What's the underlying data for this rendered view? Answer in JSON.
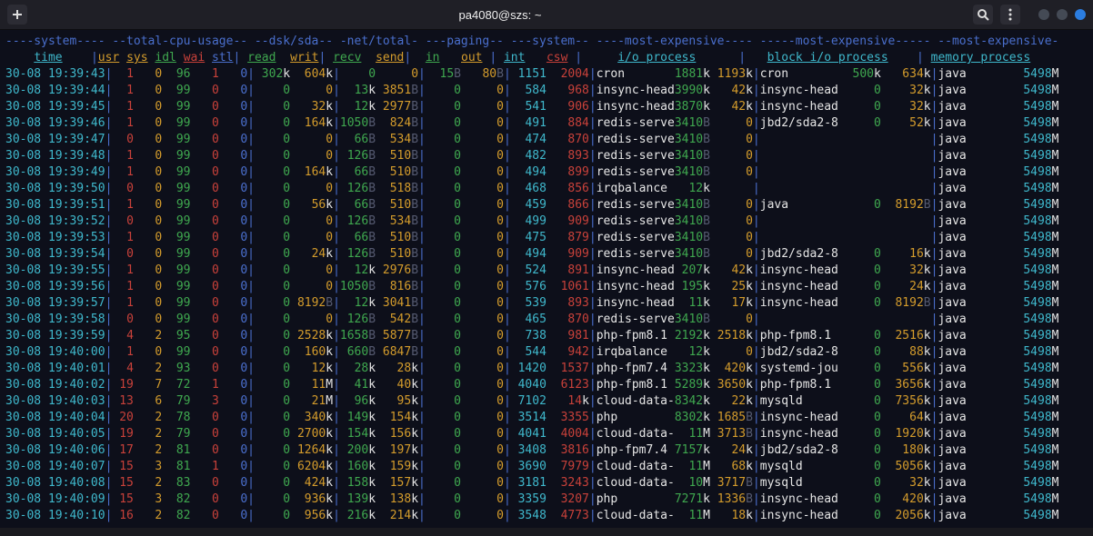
{
  "window": {
    "title": "pa4080@szs: ~"
  },
  "header": {
    "groups": "----system---- --total-cpu-usage-- --dsk/sda-- -net/total- ---paging-- ---system-- ----most-expensive---- -----most-expensive----- --most-expensive-",
    "sub": "    time    |usr sys idl wai stl| read  writ| recv  send|  in   out | int   csw |     i/o process      |   block i/o process    | memory process "
  },
  "rows": [
    {
      "time": "30-08 19:39:43",
      "usr": "1",
      "sys": "0",
      "idl": "96",
      "wai": "1",
      "stl": "0",
      "read": "302k",
      "writ": "604k",
      "recv": "0",
      "send": "0",
      "pin": "15B",
      "pout": "80B",
      "int": "1151",
      "csw": "2004",
      "io": {
        "name": "cron",
        "a": "1881k",
        "b": "1193k"
      },
      "blk": {
        "name": "cron",
        "a": "500k",
        "b": "634k"
      },
      "mem": {
        "name": "java",
        "v": "5498M"
      }
    },
    {
      "time": "30-08 19:39:44",
      "usr": "1",
      "sys": "0",
      "idl": "99",
      "wai": "0",
      "stl": "0",
      "read": "0",
      "writ": "0",
      "recv": "13k",
      "send": "3851B",
      "pin": "0",
      "pout": "0",
      "int": "584",
      "csw": "968",
      "io": {
        "name": "insync-head",
        "a": "3990k",
        "b": "42k"
      },
      "blk": {
        "name": "insync-head",
        "a": "0",
        "b": "32k"
      },
      "mem": {
        "name": "java",
        "v": "5498M"
      }
    },
    {
      "time": "30-08 19:39:45",
      "usr": "1",
      "sys": "0",
      "idl": "99",
      "wai": "0",
      "stl": "0",
      "read": "0",
      "writ": "32k",
      "recv": "12k",
      "send": "2977B",
      "pin": "0",
      "pout": "0",
      "int": "541",
      "csw": "906",
      "io": {
        "name": "insync-head",
        "a": "3870k",
        "b": "42k"
      },
      "blk": {
        "name": "insync-head",
        "a": "0",
        "b": "32k"
      },
      "mem": {
        "name": "java",
        "v": "5498M"
      }
    },
    {
      "time": "30-08 19:39:46",
      "usr": "1",
      "sys": "0",
      "idl": "99",
      "wai": "0",
      "stl": "0",
      "read": "0",
      "writ": "164k",
      "recv": "1050B",
      "send": "824B",
      "pin": "0",
      "pout": "0",
      "int": "491",
      "csw": "884",
      "io": {
        "name": "redis-serve",
        "a": "3410B",
        "b": "0"
      },
      "blk": {
        "name": "jbd2/sda2-8",
        "a": "0",
        "b": "52k"
      },
      "mem": {
        "name": "java",
        "v": "5498M"
      }
    },
    {
      "time": "30-08 19:39:47",
      "usr": "0",
      "sys": "0",
      "idl": "99",
      "wai": "0",
      "stl": "0",
      "read": "0",
      "writ": "0",
      "recv": "66B",
      "send": "534B",
      "pin": "0",
      "pout": "0",
      "int": "474",
      "csw": "870",
      "io": {
        "name": "redis-serve",
        "a": "3410B",
        "b": "0"
      },
      "blk": {
        "name": "",
        "a": "",
        "b": ""
      },
      "mem": {
        "name": "java",
        "v": "5498M"
      }
    },
    {
      "time": "30-08 19:39:48",
      "usr": "1",
      "sys": "0",
      "idl": "99",
      "wai": "0",
      "stl": "0",
      "read": "0",
      "writ": "0",
      "recv": "126B",
      "send": "510B",
      "pin": "0",
      "pout": "0",
      "int": "482",
      "csw": "893",
      "io": {
        "name": "redis-serve",
        "a": "3410B",
        "b": "0"
      },
      "blk": {
        "name": "",
        "a": "",
        "b": ""
      },
      "mem": {
        "name": "java",
        "v": "5498M"
      }
    },
    {
      "time": "30-08 19:39:49",
      "usr": "1",
      "sys": "0",
      "idl": "99",
      "wai": "0",
      "stl": "0",
      "read": "0",
      "writ": "164k",
      "recv": "66B",
      "send": "510B",
      "pin": "0",
      "pout": "0",
      "int": "494",
      "csw": "899",
      "io": {
        "name": "redis-serve",
        "a": "3410B",
        "b": "0"
      },
      "blk": {
        "name": "",
        "a": "",
        "b": ""
      },
      "mem": {
        "name": "java",
        "v": "5498M"
      }
    },
    {
      "time": "30-08 19:39:50",
      "usr": "0",
      "sys": "0",
      "idl": "99",
      "wai": "0",
      "stl": "0",
      "read": "0",
      "writ": "0",
      "recv": "126B",
      "send": "518B",
      "pin": "0",
      "pout": "0",
      "int": "468",
      "csw": "856",
      "io": {
        "name": "irqbalance",
        "a": "12k",
        "b": ""
      },
      "blk": {
        "name": "",
        "a": "",
        "b": ""
      },
      "mem": {
        "name": "java",
        "v": "5498M"
      }
    },
    {
      "time": "30-08 19:39:51",
      "usr": "1",
      "sys": "0",
      "idl": "99",
      "wai": "0",
      "stl": "0",
      "read": "0",
      "writ": "56k",
      "recv": "66B",
      "send": "510B",
      "pin": "0",
      "pout": "0",
      "int": "459",
      "csw": "866",
      "io": {
        "name": "redis-serve",
        "a": "3410B",
        "b": "0"
      },
      "blk": {
        "name": "java",
        "a": "0",
        "b": "8192B"
      },
      "mem": {
        "name": "java",
        "v": "5498M"
      }
    },
    {
      "time": "30-08 19:39:52",
      "usr": "0",
      "sys": "0",
      "idl": "99",
      "wai": "0",
      "stl": "0",
      "read": "0",
      "writ": "0",
      "recv": "126B",
      "send": "534B",
      "pin": "0",
      "pout": "0",
      "int": "499",
      "csw": "909",
      "io": {
        "name": "redis-serve",
        "a": "3410B",
        "b": "0"
      },
      "blk": {
        "name": "",
        "a": "",
        "b": ""
      },
      "mem": {
        "name": "java",
        "v": "5498M"
      }
    },
    {
      "time": "30-08 19:39:53",
      "usr": "1",
      "sys": "0",
      "idl": "99",
      "wai": "0",
      "stl": "0",
      "read": "0",
      "writ": "0",
      "recv": "66B",
      "send": "510B",
      "pin": "0",
      "pout": "0",
      "int": "475",
      "csw": "879",
      "io": {
        "name": "redis-serve",
        "a": "3410B",
        "b": "0"
      },
      "blk": {
        "name": "",
        "a": "",
        "b": ""
      },
      "mem": {
        "name": "java",
        "v": "5498M"
      }
    },
    {
      "time": "30-08 19:39:54",
      "usr": "0",
      "sys": "0",
      "idl": "99",
      "wai": "0",
      "stl": "0",
      "read": "0",
      "writ": "24k",
      "recv": "126B",
      "send": "510B",
      "pin": "0",
      "pout": "0",
      "int": "494",
      "csw": "909",
      "io": {
        "name": "redis-serve",
        "a": "3410B",
        "b": "0"
      },
      "blk": {
        "name": "jbd2/sda2-8",
        "a": "0",
        "b": "16k"
      },
      "mem": {
        "name": "java",
        "v": "5498M"
      }
    },
    {
      "time": "30-08 19:39:55",
      "usr": "1",
      "sys": "0",
      "idl": "99",
      "wai": "0",
      "stl": "0",
      "read": "0",
      "writ": "0",
      "recv": "12k",
      "send": "2976B",
      "pin": "0",
      "pout": "0",
      "int": "524",
      "csw": "891",
      "io": {
        "name": "insync-head",
        "a": "207k",
        "b": "42k"
      },
      "blk": {
        "name": "insync-head",
        "a": "0",
        "b": "32k"
      },
      "mem": {
        "name": "java",
        "v": "5498M"
      }
    },
    {
      "time": "30-08 19:39:56",
      "usr": "1",
      "sys": "0",
      "idl": "99",
      "wai": "0",
      "stl": "0",
      "read": "0",
      "writ": "0",
      "recv": "1050B",
      "send": "816B",
      "pin": "0",
      "pout": "0",
      "int": "576",
      "csw": "1061",
      "io": {
        "name": "insync-head",
        "a": "195k",
        "b": "25k"
      },
      "blk": {
        "name": "insync-head",
        "a": "0",
        "b": "24k"
      },
      "mem": {
        "name": "java",
        "v": "5498M"
      }
    },
    {
      "time": "30-08 19:39:57",
      "usr": "1",
      "sys": "0",
      "idl": "99",
      "wai": "0",
      "stl": "0",
      "read": "0",
      "writ": "8192B",
      "recv": "12k",
      "send": "3041B",
      "pin": "0",
      "pout": "0",
      "int": "539",
      "csw": "893",
      "io": {
        "name": "insync-head",
        "a": "11k",
        "b": "17k"
      },
      "blk": {
        "name": "insync-head",
        "a": "0",
        "b": "8192B"
      },
      "mem": {
        "name": "java",
        "v": "5498M"
      }
    },
    {
      "time": "30-08 19:39:58",
      "usr": "0",
      "sys": "0",
      "idl": "99",
      "wai": "0",
      "stl": "0",
      "read": "0",
      "writ": "0",
      "recv": "126B",
      "send": "542B",
      "pin": "0",
      "pout": "0",
      "int": "465",
      "csw": "870",
      "io": {
        "name": "redis-serve",
        "a": "3410B",
        "b": "0"
      },
      "blk": {
        "name": "",
        "a": "",
        "b": ""
      },
      "mem": {
        "name": "java",
        "v": "5498M"
      }
    },
    {
      "time": "30-08 19:39:59",
      "usr": "4",
      "sys": "2",
      "idl": "95",
      "wai": "0",
      "stl": "0",
      "read": "0",
      "writ": "2528k",
      "recv": "1658B",
      "send": "5877B",
      "pin": "0",
      "pout": "0",
      "int": "738",
      "csw": "981",
      "io": {
        "name": "php-fpm8.1",
        "a": "2192k",
        "b": "2518k"
      },
      "blk": {
        "name": "php-fpm8.1",
        "a": "0",
        "b": "2516k"
      },
      "mem": {
        "name": "java",
        "v": "5498M"
      }
    },
    {
      "time": "30-08 19:40:00",
      "usr": "1",
      "sys": "0",
      "idl": "99",
      "wai": "0",
      "stl": "0",
      "read": "0",
      "writ": "160k",
      "recv": "660B",
      "send": "6847B",
      "pin": "0",
      "pout": "0",
      "int": "544",
      "csw": "942",
      "io": {
        "name": "irqbalance",
        "a": "12k",
        "b": "0"
      },
      "blk": {
        "name": "jbd2/sda2-8",
        "a": "0",
        "b": "88k"
      },
      "mem": {
        "name": "java",
        "v": "5498M"
      }
    },
    {
      "time": "30-08 19:40:01",
      "usr": "4",
      "sys": "2",
      "idl": "93",
      "wai": "0",
      "stl": "0",
      "read": "0",
      "writ": "12k",
      "recv": "28k",
      "send": "28k",
      "pin": "0",
      "pout": "0",
      "int": "1420",
      "csw": "1537",
      "io": {
        "name": "php-fpm7.4",
        "a": "3323k",
        "b": "420k"
      },
      "blk": {
        "name": "systemd-jou",
        "a": "0",
        "b": "556k"
      },
      "mem": {
        "name": "java",
        "v": "5498M"
      }
    },
    {
      "time": "30-08 19:40:02",
      "usr": "19",
      "sys": "7",
      "idl": "72",
      "wai": "1",
      "stl": "0",
      "read": "0",
      "writ": "11M",
      "recv": "41k",
      "send": "40k",
      "pin": "0",
      "pout": "0",
      "int": "4040",
      "csw": "6123",
      "io": {
        "name": "php-fpm8.1",
        "a": "5289k",
        "b": "3650k"
      },
      "blk": {
        "name": "php-fpm8.1",
        "a": "0",
        "b": "3656k"
      },
      "mem": {
        "name": "java",
        "v": "5498M"
      }
    },
    {
      "time": "30-08 19:40:03",
      "usr": "13",
      "sys": "6",
      "idl": "79",
      "wai": "3",
      "stl": "0",
      "read": "0",
      "writ": "21M",
      "recv": "96k",
      "send": "95k",
      "pin": "0",
      "pout": "0",
      "int": "7102",
      "csw": "14k",
      "io": {
        "name": "cloud-data-",
        "a": "8342k",
        "b": "22k"
      },
      "blk": {
        "name": "mysqld",
        "a": "0",
        "b": "7356k"
      },
      "mem": {
        "name": "java",
        "v": "5498M"
      }
    },
    {
      "time": "30-08 19:40:04",
      "usr": "20",
      "sys": "2",
      "idl": "78",
      "wai": "0",
      "stl": "0",
      "read": "0",
      "writ": "340k",
      "recv": "149k",
      "send": "154k",
      "pin": "0",
      "pout": "0",
      "int": "3514",
      "csw": "3355",
      "io": {
        "name": "php",
        "a": "8302k",
        "b": "1685B"
      },
      "blk": {
        "name": "insync-head",
        "a": "0",
        "b": "64k"
      },
      "mem": {
        "name": "java",
        "v": "5498M"
      }
    },
    {
      "time": "30-08 19:40:05",
      "usr": "19",
      "sys": "2",
      "idl": "79",
      "wai": "0",
      "stl": "0",
      "read": "0",
      "writ": "2700k",
      "recv": "154k",
      "send": "156k",
      "pin": "0",
      "pout": "0",
      "int": "4041",
      "csw": "4004",
      "io": {
        "name": "cloud-data-",
        "a": "11M",
        "b": "3713B"
      },
      "blk": {
        "name": "insync-head",
        "a": "0",
        "b": "1920k"
      },
      "mem": {
        "name": "java",
        "v": "5498M"
      }
    },
    {
      "time": "30-08 19:40:06",
      "usr": "17",
      "sys": "2",
      "idl": "81",
      "wai": "0",
      "stl": "0",
      "read": "0",
      "writ": "1264k",
      "recv": "200k",
      "send": "197k",
      "pin": "0",
      "pout": "0",
      "int": "3408",
      "csw": "3816",
      "io": {
        "name": "php-fpm7.4",
        "a": "7157k",
        "b": "24k"
      },
      "blk": {
        "name": "jbd2/sda2-8",
        "a": "0",
        "b": "180k"
      },
      "mem": {
        "name": "java",
        "v": "5498M"
      }
    },
    {
      "time": "30-08 19:40:07",
      "usr": "15",
      "sys": "3",
      "idl": "81",
      "wai": "1",
      "stl": "0",
      "read": "0",
      "writ": "6204k",
      "recv": "160k",
      "send": "159k",
      "pin": "0",
      "pout": "0",
      "int": "3690",
      "csw": "7979",
      "io": {
        "name": "cloud-data-",
        "a": "11M",
        "b": "68k"
      },
      "blk": {
        "name": "mysqld",
        "a": "0",
        "b": "5056k"
      },
      "mem": {
        "name": "java",
        "v": "5498M"
      }
    },
    {
      "time": "30-08 19:40:08",
      "usr": "15",
      "sys": "2",
      "idl": "83",
      "wai": "0",
      "stl": "0",
      "read": "0",
      "writ": "424k",
      "recv": "158k",
      "send": "157k",
      "pin": "0",
      "pout": "0",
      "int": "3181",
      "csw": "3243",
      "io": {
        "name": "cloud-data-",
        "a": "10M",
        "b": "3717B"
      },
      "blk": {
        "name": "mysqld",
        "a": "0",
        "b": "32k"
      },
      "mem": {
        "name": "java",
        "v": "5498M"
      }
    },
    {
      "time": "30-08 19:40:09",
      "usr": "15",
      "sys": "3",
      "idl": "82",
      "wai": "0",
      "stl": "0",
      "read": "0",
      "writ": "936k",
      "recv": "139k",
      "send": "138k",
      "pin": "0",
      "pout": "0",
      "int": "3359",
      "csw": "3207",
      "io": {
        "name": "php",
        "a": "7271k",
        "b": "1336B"
      },
      "blk": {
        "name": "insync-head",
        "a": "0",
        "b": "420k"
      },
      "mem": {
        "name": "java",
        "v": "5498M"
      }
    },
    {
      "time": "30-08 19:40:10",
      "usr": "16",
      "sys": "2",
      "idl": "82",
      "wai": "0",
      "stl": "0",
      "read": "0",
      "writ": "956k",
      "recv": "216k",
      "send": "214k",
      "pin": "0",
      "pout": "0",
      "int": "3548",
      "csw": "4773",
      "io": {
        "name": "cloud-data-",
        "a": "11M",
        "b": "18k"
      },
      "blk": {
        "name": "insync-head",
        "a": "0",
        "b": "2056k"
      },
      "mem": {
        "name": "java",
        "v": "5498M"
      }
    }
  ]
}
